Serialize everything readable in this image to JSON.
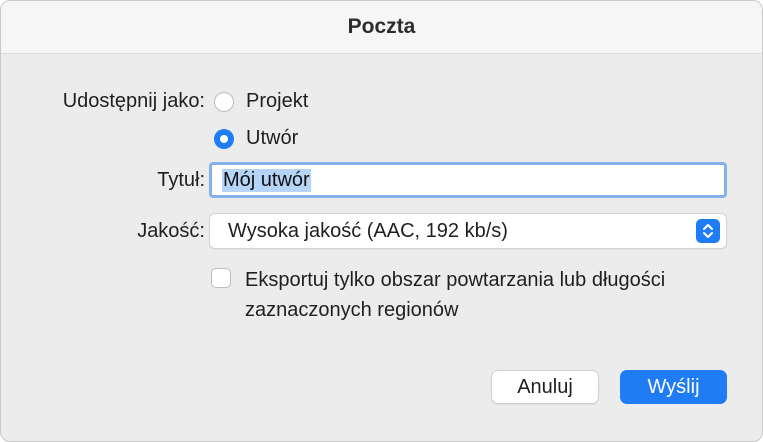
{
  "window": {
    "title": "Poczta"
  },
  "share_as": {
    "label": "Udostępnij jako:",
    "options": [
      {
        "label": "Projekt",
        "selected": false
      },
      {
        "label": "Utwór",
        "selected": true
      }
    ]
  },
  "title_field": {
    "label": "Tytuł:",
    "value": "Mój utwór"
  },
  "quality": {
    "label": "Jakość:",
    "selected": "Wysoka jakość (AAC, 192 kb/s)"
  },
  "export_option": {
    "checked": false,
    "label": "Eksportuj tylko obszar powtarzania lub długości zaznaczonych regionów"
  },
  "buttons": {
    "cancel": "Anuluj",
    "send": "Wyślij"
  },
  "colors": {
    "accent": "#1f7cf5",
    "selection": "#b6d4f7"
  },
  "icons": {
    "stepper": "chevron-up-down-icon"
  }
}
